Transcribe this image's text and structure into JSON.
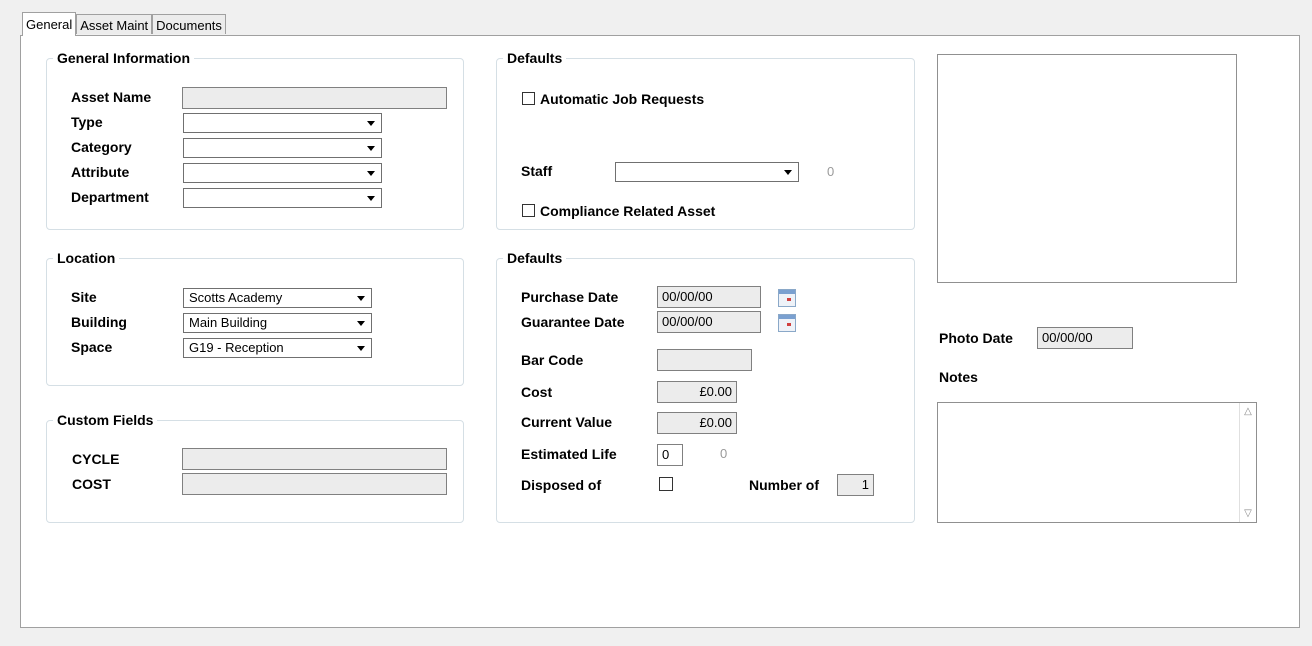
{
  "tabs": [
    {
      "label": "General",
      "active": true
    },
    {
      "label": "Asset Maint"
    },
    {
      "label": "Documents"
    }
  ],
  "general_info": {
    "title": "General Information",
    "asset_name_label": "Asset Name",
    "asset_name_value": "",
    "type_label": "Type",
    "type_value": "",
    "category_label": "Category",
    "category_value": "",
    "attribute_label": "Attribute",
    "attribute_value": "",
    "department_label": "Department",
    "department_value": ""
  },
  "location": {
    "title": "Location",
    "site_label": "Site",
    "site_value": "Scotts Academy",
    "building_label": "Building",
    "building_value": "Main Building",
    "space_label": "Space",
    "space_value": "G19 - Reception"
  },
  "custom_fields": {
    "title": "Custom Fields",
    "cycle_label": "CYCLE",
    "cycle_value": "",
    "cost_label": "COST",
    "cost_value": ""
  },
  "defaults_top": {
    "title": "Defaults",
    "auto_job_label": "Automatic Job Requests",
    "staff_label": "Staff",
    "staff_value": "",
    "staff_count": "0",
    "compliance_label": "Compliance Related Asset"
  },
  "defaults_bottom": {
    "title": "Defaults",
    "purchase_date_label": "Purchase Date",
    "purchase_date_value": "00/00/00",
    "guarantee_date_label": "Guarantee Date",
    "guarantee_date_value": "00/00/00",
    "bar_code_label": "Bar Code",
    "bar_code_value": "",
    "cost_label": "Cost",
    "cost_value": "£0.00",
    "current_value_label": "Current Value",
    "current_value_value": "£0.00",
    "estimated_life_label": "Estimated Life",
    "estimated_life_value": "0",
    "estimated_life_extra": "0",
    "disposed_of_label": "Disposed of",
    "number_of_label": "Number of",
    "number_of_value": "1"
  },
  "photo": {
    "photo_date_label": "Photo Date",
    "photo_date_value": "00/00/00",
    "notes_label": "Notes"
  },
  "icons": {
    "dropdown": "chevron-down-icon",
    "calendar": "calendar-icon",
    "scroll_up": "scroll-up-icon",
    "scroll_down": "scroll-down-icon"
  }
}
